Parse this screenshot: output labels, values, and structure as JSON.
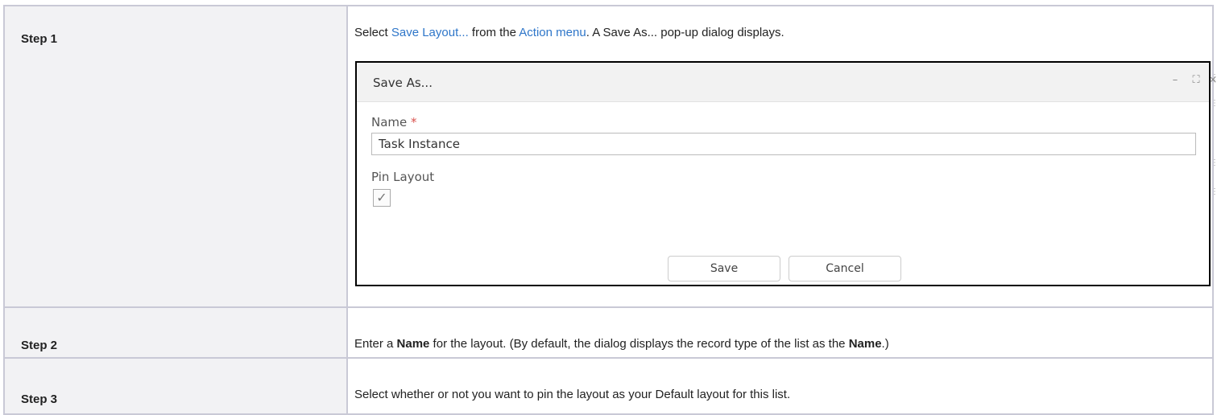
{
  "steps": [
    {
      "label": "Step 1",
      "text_before": "Select ",
      "link1": "Save Layout...",
      "text_mid": " from the ",
      "link2": "Action menu",
      "text_after": ". A Save As... pop-up dialog displays."
    },
    {
      "label": "Step 2",
      "text_a": "Enter a ",
      "bold_a": "Name",
      "text_b": " for the layout. (By default, the dialog displays the record type of the list as the ",
      "bold_b": "Name",
      "text_c": ".)"
    },
    {
      "label": "Step 3",
      "text": "Select whether or not you want to pin the layout as your Default layout for this list."
    }
  ],
  "dialog": {
    "title": "Save As...",
    "minimize_glyph": "–",
    "maximize_glyph": "⛶",
    "close_glyph": "×",
    "name_label": "Name",
    "required_mark": "*",
    "name_value": "Task Instance",
    "pin_label": "Pin Layout",
    "pin_checked_glyph": "✓",
    "save_label": "Save",
    "cancel_label": "Cancel"
  },
  "colors": {
    "link": "#2e76c9",
    "required": "#d9534f",
    "step_cell_bg": "#f2f2f4"
  }
}
